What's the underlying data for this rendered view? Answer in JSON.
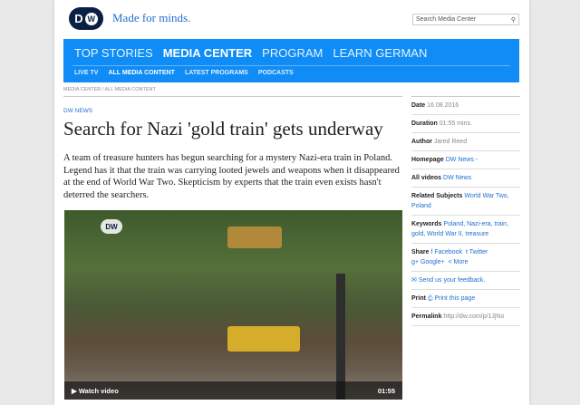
{
  "header": {
    "logo": "DW",
    "tagline": "Made for minds.",
    "search_placeholder": "Search Media Center",
    "search_icon": "search-icon"
  },
  "nav": {
    "primary": [
      "TOP STORIES",
      "MEDIA CENTER",
      "PROGRAM",
      "LEARN GERMAN"
    ],
    "secondary": [
      "LIVE TV",
      "ALL MEDIA CONTENT",
      "LATEST PROGRAMS",
      "PODCASTS"
    ]
  },
  "breadcrumb": "MEDIA CENTER / ALL MEDIA CONTENT",
  "article": {
    "category": "DW NEWS",
    "title": "Search for Nazi 'gold train' gets underway",
    "teaser": "A team of treasure hunters has begun searching for a mystery Nazi-era train in Poland. Legend has it that the train was carrying looted jewels and weapons when it disappeared at the end of World War Two. Skepticism by experts that the train even exists hasn't deterred the searchers."
  },
  "video": {
    "watch_label": "Watch video",
    "duration": "01:55",
    "bug": "DW"
  },
  "sidebar": {
    "date_label": "Date",
    "date": "16.08.2016",
    "duration_label": "Duration",
    "duration": "01:55 mins.",
    "author_label": "Author",
    "author": "Jared Reed",
    "homepage_label": "Homepage",
    "homepage": "DW News -",
    "allvideos_label": "All videos",
    "allvideos": "DW News",
    "related_label": "Related Subjects",
    "related": "World War Two, Poland",
    "keywords_label": "Keywords",
    "keywords": "Poland, Nazi-era, train, gold, World War II, treasure",
    "share_label": "Share",
    "facebook": "Facebook",
    "twitter": "Twitter",
    "google": "Google+",
    "more": "More",
    "feedback": "Send us your feedback.",
    "print_label": "Print",
    "print": "Print this page",
    "permalink_label": "Permalink",
    "permalink": "http://dw.com/p/1JjNo"
  },
  "colors": {
    "brand_blue": "#0f8cf5",
    "link": "#1f6fd1"
  }
}
